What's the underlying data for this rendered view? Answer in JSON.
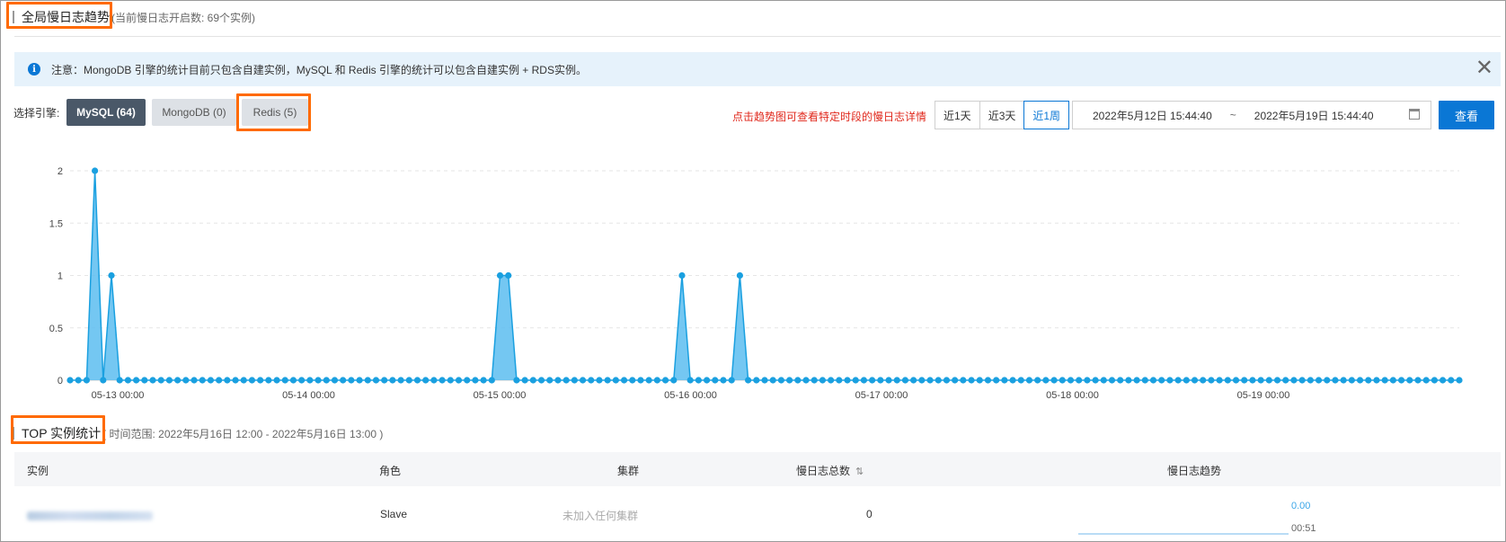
{
  "header": {
    "title": "全局慢日志趋势",
    "subtitle": "(当前慢日志开启数: 69个实例)"
  },
  "notice": {
    "text": "注意：MongoDB 引擎的统计目前只包含自建实例，MySQL 和 Redis 引擎的统计可以包含自建实例 + RDS实例。",
    "info_icon": "i",
    "close_glyph": "✕"
  },
  "engine_selector": {
    "label": "选择引擎:",
    "options": [
      {
        "label": "MySQL (64)",
        "active": true
      },
      {
        "label": "MongoDB (0)",
        "active": false
      },
      {
        "label": "Redis (5)",
        "active": false
      }
    ]
  },
  "filters": {
    "hint": "点击趋势图可查看特定时段的慢日志详情",
    "ranges": [
      "近1天",
      "近3天",
      "近1周"
    ],
    "selected_range": "近1周",
    "date_start": "2022年5月12日 15:44:40",
    "date_separator": "~",
    "date_end": "2022年5月19日 15:44:40",
    "query_label": "查看"
  },
  "chart_data": {
    "type": "area",
    "color": "#1aa0e0",
    "y_ticks": [
      "0",
      "0.5",
      "1",
      "1.5",
      "2"
    ],
    "ylim": [
      0,
      2
    ],
    "grid": true,
    "x_ticks": [
      "05-13 00:00",
      "05-14 00:00",
      "05-15 00:00",
      "05-16 00:00",
      "05-17 00:00",
      "05-18 00:00",
      "05-19 00:00"
    ],
    "points_total": 169,
    "nonzero": [
      {
        "index": 3,
        "value": 2
      },
      {
        "index": 5,
        "value": 1
      },
      {
        "index": 52,
        "value": 1
      },
      {
        "index": 53,
        "value": 1
      },
      {
        "index": 74,
        "value": 1
      },
      {
        "index": 81,
        "value": 1
      }
    ]
  },
  "top_section": {
    "title": "TOP 实例统计",
    "subtitle": "( 时间范围: 2022年5月16日 12:00 - 2022年5月16日 13:00 )"
  },
  "table": {
    "columns": [
      "实例",
      "角色",
      "集群",
      "慢日志总数",
      "慢日志趋势"
    ],
    "sort_icon": "⇅",
    "rows": [
      {
        "role": "Slave",
        "cluster": "未加入任何集群",
        "total": "0",
        "trend_value": "0.00",
        "trend_time": "00:51"
      }
    ]
  }
}
